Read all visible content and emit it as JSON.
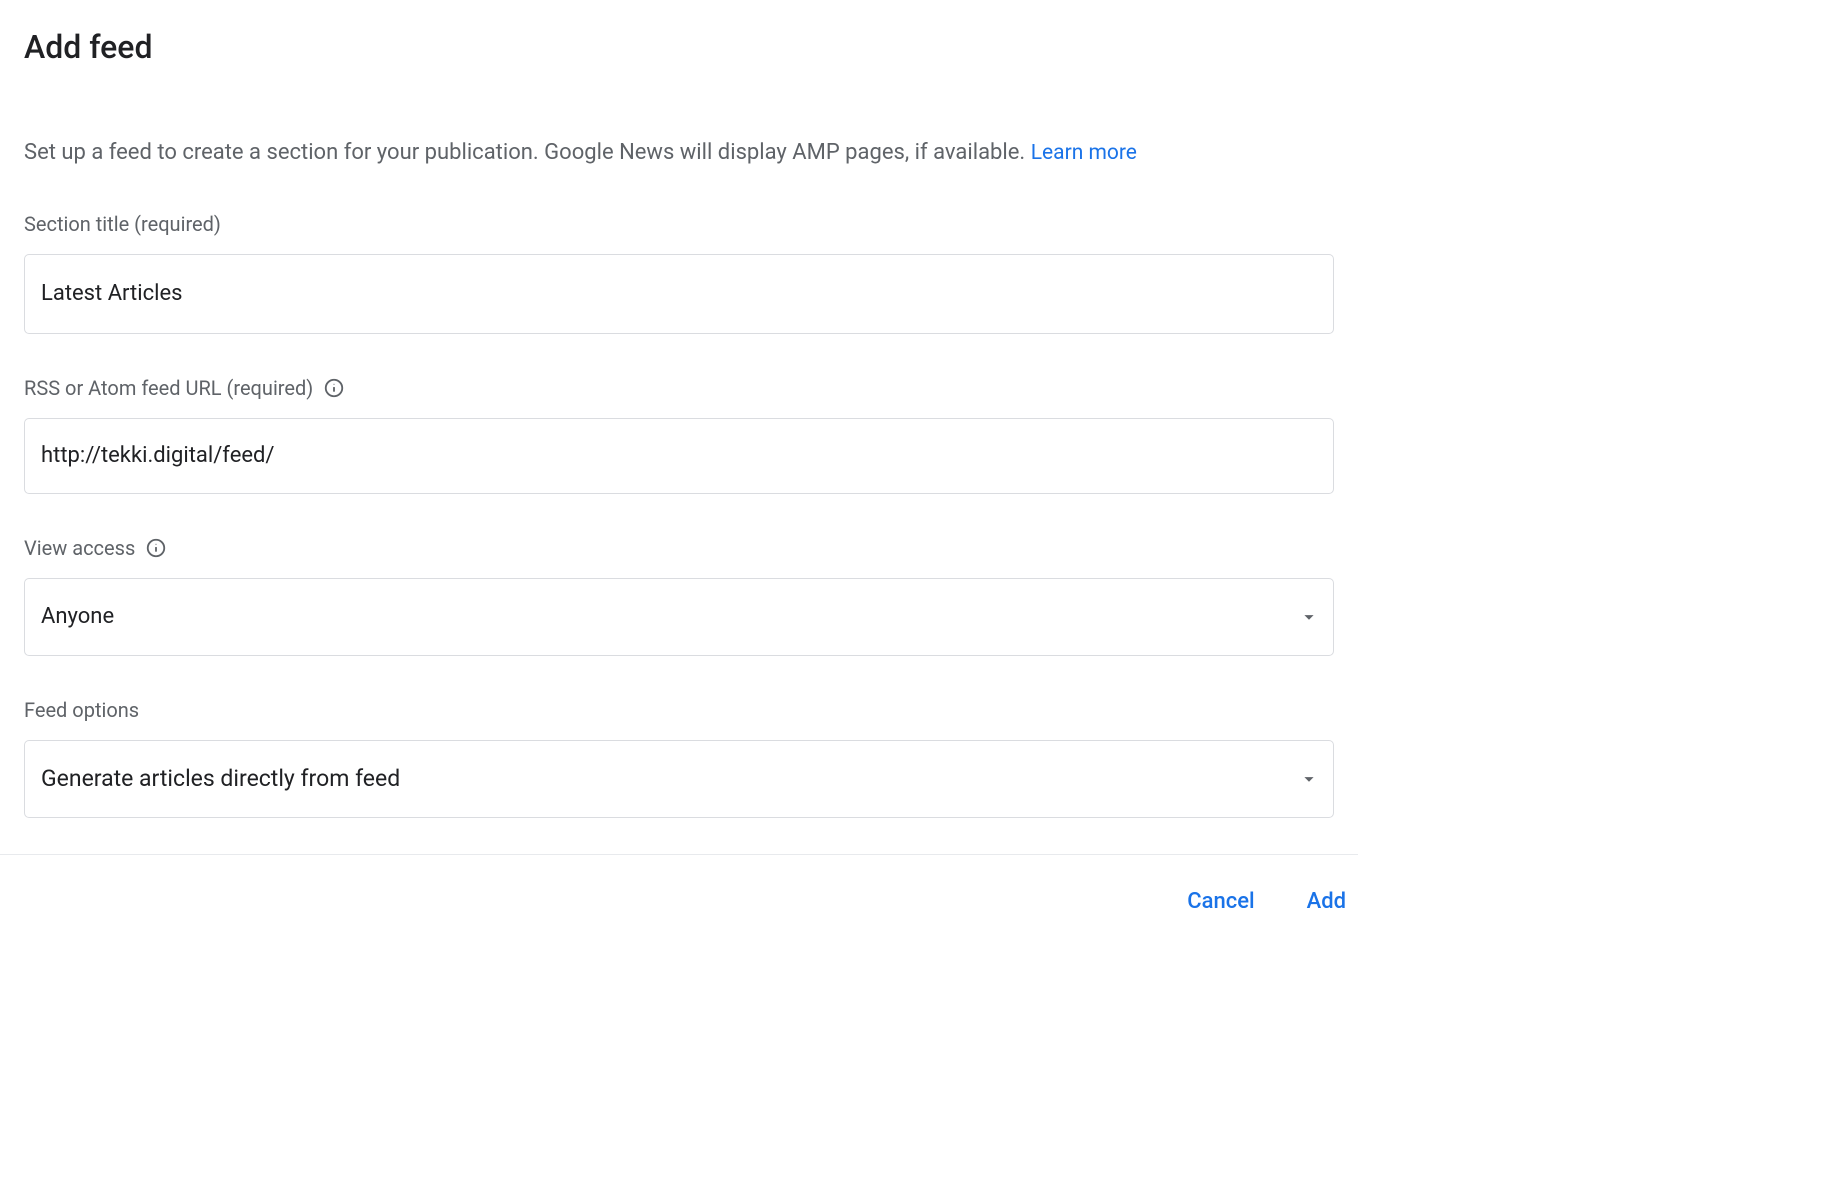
{
  "dialog": {
    "title": "Add feed",
    "help_text": "Set up a feed to create a section for your publication. Google News will display AMP pages, if available.",
    "learn_more": "Learn more"
  },
  "fields": {
    "section_title": {
      "label": "Section title (required)",
      "value": "Latest Articles"
    },
    "feed_url": {
      "label": "RSS or Atom feed URL (required)",
      "value": "http://tekki.digital/feed/"
    },
    "view_access": {
      "label": "View access",
      "selected": "Anyone"
    },
    "feed_options": {
      "label": "Feed options",
      "selected": "Generate articles directly from feed"
    }
  },
  "actions": {
    "cancel": "Cancel",
    "add": "Add"
  }
}
